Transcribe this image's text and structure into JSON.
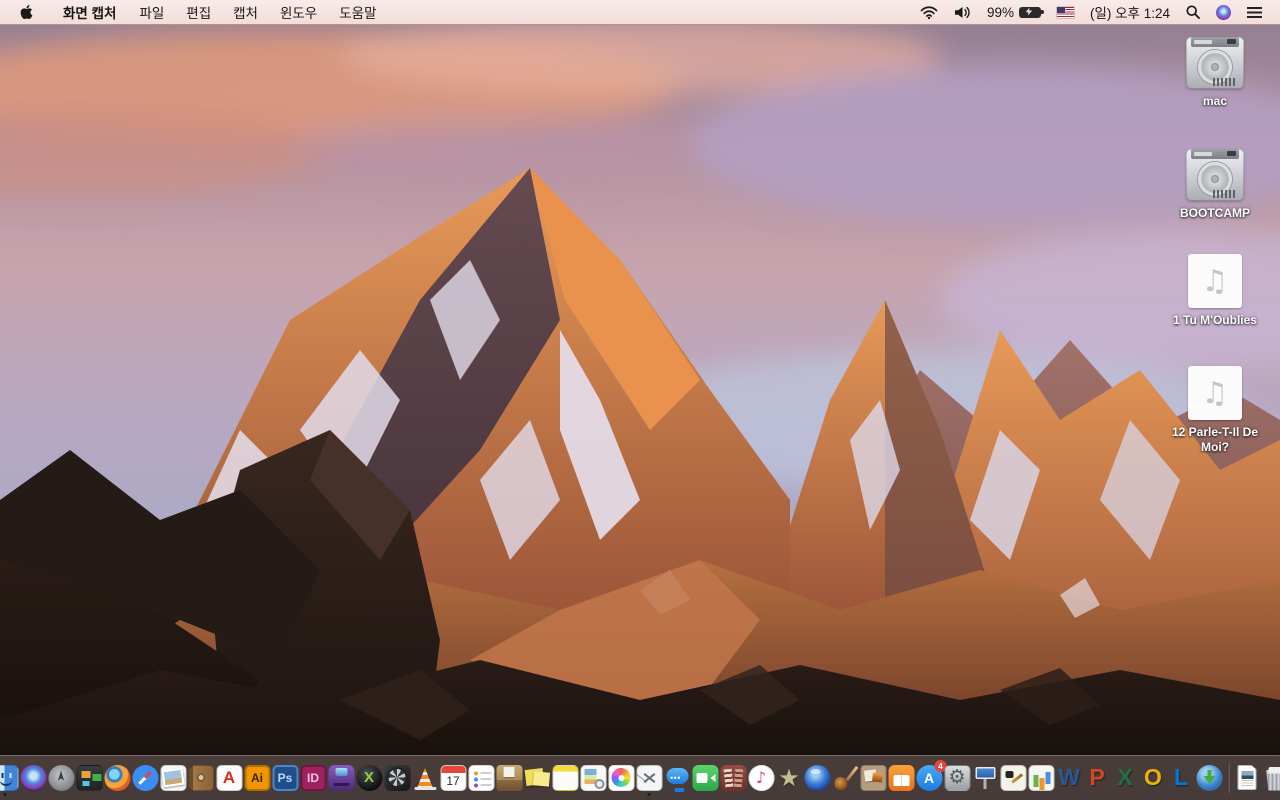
{
  "menu_bar": {
    "menus": [
      {
        "name": "app-menu",
        "label": "화면 캡처",
        "bold": true
      },
      {
        "name": "file-menu",
        "label": "파일"
      },
      {
        "name": "edit-menu",
        "label": "편집"
      },
      {
        "name": "capture-menu",
        "label": "캡처"
      },
      {
        "name": "window-menu",
        "label": "윈도우"
      },
      {
        "name": "help-menu",
        "label": "도움말"
      }
    ],
    "status": [
      {
        "type": "wifi"
      },
      {
        "type": "volume"
      },
      {
        "type": "battery",
        "text": "99%"
      },
      {
        "type": "input-flag"
      },
      {
        "type": "clock",
        "text": "(일) 오후 1:24"
      },
      {
        "type": "spotlight"
      },
      {
        "type": "siri"
      },
      {
        "type": "notification-center"
      }
    ]
  },
  "desktop": {
    "items": [
      {
        "id": "mac",
        "type": "drive",
        "label": "mac"
      },
      {
        "id": "bootcamp",
        "type": "drive",
        "label": "BOOTCAMP"
      },
      {
        "id": "song1",
        "type": "audio",
        "glyph": "♫",
        "label": "1 Tu M'Oublies"
      },
      {
        "id": "song2",
        "type": "audio",
        "glyph": "♫",
        "label": "12 Parle-T-Il De Moi?"
      }
    ]
  },
  "dock": {
    "items": [
      {
        "id": "finder",
        "name": "Finder",
        "running": true
      },
      {
        "id": "siri",
        "name": "Siri"
      },
      {
        "id": "launchpad",
        "name": "Launchpad"
      },
      {
        "id": "missionctl",
        "name": "Mission Control"
      },
      {
        "id": "firefox",
        "name": "Firefox"
      },
      {
        "id": "safari",
        "name": "Safari"
      },
      {
        "id": "preview",
        "name": "Preview"
      },
      {
        "id": "contacts",
        "name": "Contacts"
      },
      {
        "id": "acrobat",
        "name": "Adobe Acrobat Reader",
        "glyph": "A"
      },
      {
        "id": "ai",
        "name": "Adobe Illustrator",
        "glyph": "Ai"
      },
      {
        "id": "ps",
        "name": "Adobe Photoshop",
        "glyph": "Ps"
      },
      {
        "id": "id",
        "name": "Adobe InDesign",
        "glyph": "ID"
      },
      {
        "id": "toast",
        "name": "Toast"
      },
      {
        "id": "divx",
        "name": "DivX",
        "glyph": "X"
      },
      {
        "id": "fan",
        "name": "Fan Utility"
      },
      {
        "id": "vlc",
        "name": "VLC"
      },
      {
        "id": "cal",
        "name": "Calendar",
        "glyph": "17"
      },
      {
        "id": "rem",
        "name": "Reminders"
      },
      {
        "id": "unarch",
        "name": "Archive Utility"
      },
      {
        "id": "stick",
        "name": "Stickies"
      },
      {
        "id": "notes",
        "name": "Notes"
      },
      {
        "id": "anot",
        "name": "Documents"
      },
      {
        "id": "photos",
        "name": "Photos"
      },
      {
        "id": "grab",
        "name": "화면 캡처",
        "running": true
      },
      {
        "id": "messages",
        "name": "Messages"
      },
      {
        "id": "facetime",
        "name": "FaceTime"
      },
      {
        "id": "pbooth",
        "name": "Photo Booth"
      },
      {
        "id": "itunes",
        "name": "iTunes",
        "glyph": "♪"
      },
      {
        "id": "imovie",
        "name": "iMovie",
        "glyph": "★"
      },
      {
        "id": "dvd",
        "name": "DVD Player"
      },
      {
        "id": "gband",
        "name": "GarageBand"
      },
      {
        "id": "collage",
        "name": "Collage"
      },
      {
        "id": "ibooks",
        "name": "iBooks"
      },
      {
        "id": "appstore",
        "name": "App Store",
        "glyph": "A",
        "badge": "4"
      },
      {
        "id": "sysprefs",
        "name": "System Preferences",
        "glyph": "⚙"
      },
      {
        "id": "keynote",
        "name": "Keynote"
      },
      {
        "id": "pages09",
        "name": "Pages"
      },
      {
        "id": "numbers09",
        "name": "Numbers"
      },
      {
        "id": "word",
        "name": "Microsoft Word",
        "glyph": "W",
        "letter": true
      },
      {
        "id": "ppt",
        "name": "Microsoft PowerPoint",
        "glyph": "P",
        "letter": true
      },
      {
        "id": "excel",
        "name": "Microsoft Excel",
        "glyph": "X",
        "letter": true
      },
      {
        "id": "outlook",
        "name": "Microsoft Outlook",
        "glyph": "O",
        "letter": true
      },
      {
        "id": "lync",
        "name": "Microsoft Lync",
        "glyph": "L",
        "letter": true
      },
      {
        "id": "downl",
        "name": "Download Manager"
      },
      {
        "id": "divider"
      },
      {
        "id": "docfile",
        "name": "Document File"
      },
      {
        "id": "trash",
        "name": "Trash"
      }
    ]
  }
}
